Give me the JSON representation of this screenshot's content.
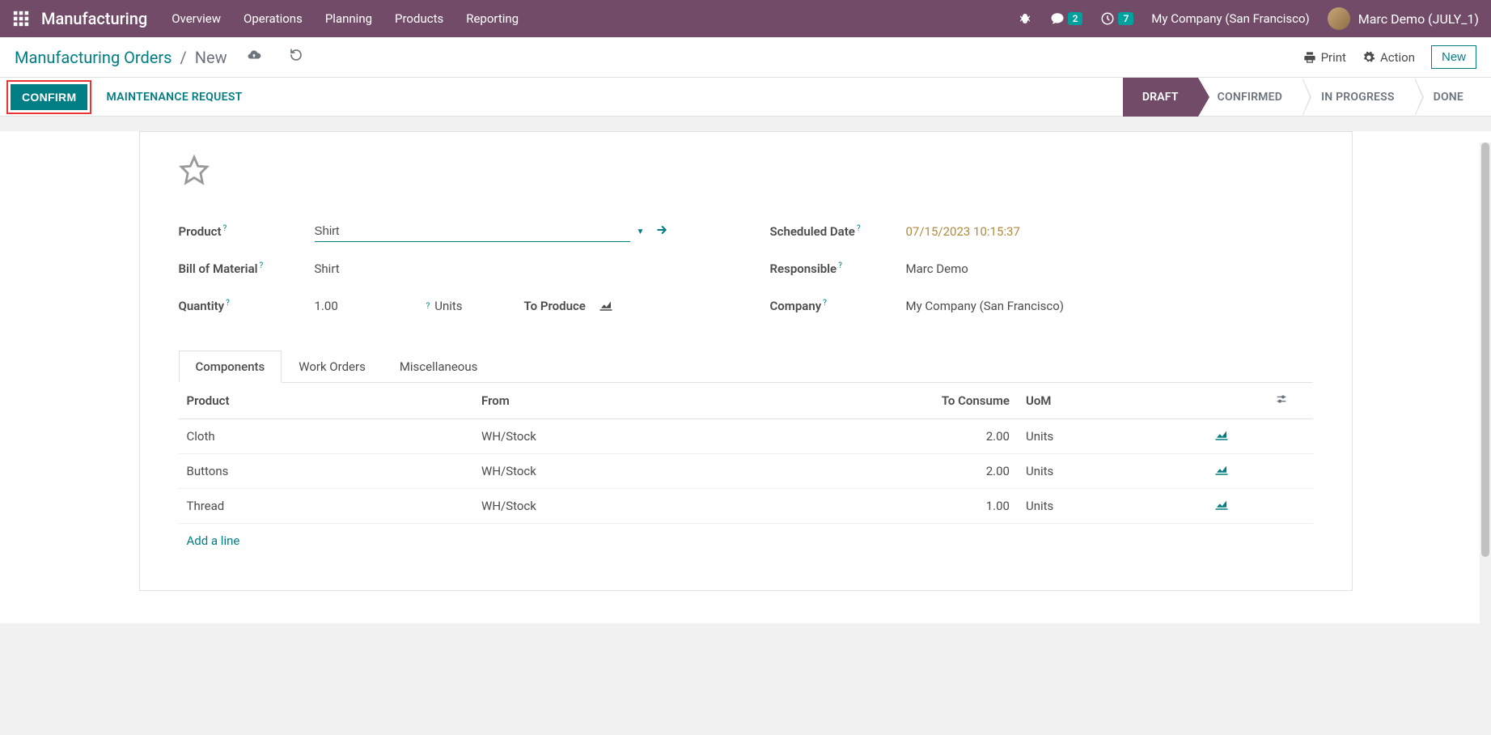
{
  "navbar": {
    "brand": "Manufacturing",
    "menu": [
      "Overview",
      "Operations",
      "Planning",
      "Products",
      "Reporting"
    ],
    "messaging_badge": "2",
    "activity_badge": "7",
    "company": "My Company (San Francisco)",
    "user": "Marc Demo (JULY_1)"
  },
  "breadcrumb": {
    "root": "Manufacturing Orders",
    "current": "New"
  },
  "control_panel": {
    "print": "Print",
    "action": "Action",
    "new": "New"
  },
  "status_bar": {
    "confirm": "CONFIRM",
    "maintenance": "MAINTENANCE REQUEST",
    "steps": [
      "DRAFT",
      "CONFIRMED",
      "IN PROGRESS",
      "DONE"
    ],
    "active_index": 0
  },
  "form": {
    "left": {
      "product_label": "Product",
      "product_value": "Shirt",
      "bom_label": "Bill of Material",
      "bom_value": "Shirt",
      "qty_label": "Quantity",
      "qty_value": "1.00",
      "qty_unit": "Units",
      "to_produce": "To Produce"
    },
    "right": {
      "sched_label": "Scheduled Date",
      "sched_value": "07/15/2023 10:15:37",
      "resp_label": "Responsible",
      "resp_value": "Marc Demo",
      "company_label": "Company",
      "company_value": "My Company (San Francisco)"
    }
  },
  "tabs": [
    "Components",
    "Work Orders",
    "Miscellaneous"
  ],
  "table": {
    "headers": {
      "product": "Product",
      "from": "From",
      "to_consume": "To Consume",
      "uom": "UoM"
    },
    "rows": [
      {
        "product": "Cloth",
        "from": "WH/Stock",
        "to_consume": "2.00",
        "uom": "Units"
      },
      {
        "product": "Buttons",
        "from": "WH/Stock",
        "to_consume": "2.00",
        "uom": "Units"
      },
      {
        "product": "Thread",
        "from": "WH/Stock",
        "to_consume": "1.00",
        "uom": "Units"
      }
    ],
    "add_line": "Add a line"
  }
}
